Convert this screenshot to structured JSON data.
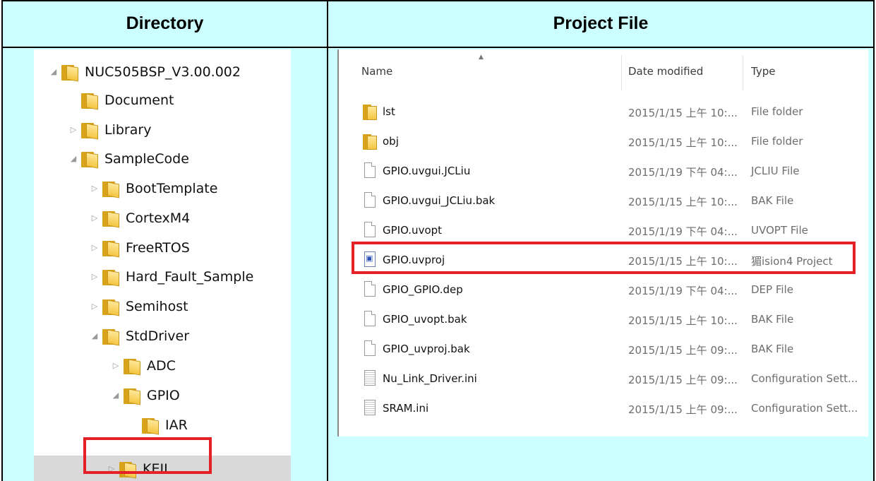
{
  "header": {
    "directory": "Directory",
    "project_file": "Project File"
  },
  "tree": [
    {
      "label": "NUC505BSP_V3.00.002",
      "expander": "◢"
    },
    {
      "label": "Document",
      "expander": ""
    },
    {
      "label": "Library",
      "expander": "▷"
    },
    {
      "label": "SampleCode",
      "expander": "◢"
    },
    {
      "label": "BootTemplate",
      "expander": "▷"
    },
    {
      "label": "CortexM4",
      "expander": "▷"
    },
    {
      "label": "FreeRTOS",
      "expander": "▷"
    },
    {
      "label": "Hard_Fault_Sample",
      "expander": "▷"
    },
    {
      "label": "Semihost",
      "expander": "▷"
    },
    {
      "label": "StdDriver",
      "expander": "◢"
    },
    {
      "label": "ADC",
      "expander": "▷"
    },
    {
      "label": "GPIO",
      "expander": "◢"
    },
    {
      "label": "IAR",
      "expander": ""
    },
    {
      "label": "KEIL",
      "expander": "▷"
    }
  ],
  "file_list": {
    "columns": {
      "name": "Name",
      "date": "Date modified",
      "type": "Type"
    },
    "sort_indicator": "▲",
    "rows": [
      {
        "name": "lst",
        "date": "2015/1/15 上午 10:...",
        "type": "File folder",
        "icon": "folder-icon"
      },
      {
        "name": "obj",
        "date": "2015/1/15 上午 10:...",
        "type": "File folder",
        "icon": "folder-icon"
      },
      {
        "name": "GPIO.uvgui.JCLiu",
        "date": "2015/1/19 下午 04:...",
        "type": "JCLIU File",
        "icon": "file-icon"
      },
      {
        "name": "GPIO.uvgui_JCLiu.bak",
        "date": "2015/1/15 上午 10:...",
        "type": "BAK File",
        "icon": "file-icon"
      },
      {
        "name": "GPIO.uvopt",
        "date": "2015/1/19 下午 04:...",
        "type": "UVOPT File",
        "icon": "file-icon"
      },
      {
        "name": "GPIO.uvproj",
        "date": "2015/1/15 上午 10:...",
        "type": "猸ision4 Project",
        "icon": "project-icon"
      },
      {
        "name": "GPIO_GPIO.dep",
        "date": "2015/1/19 下午 04:...",
        "type": "DEP File",
        "icon": "file-icon"
      },
      {
        "name": "GPIO_uvopt.bak",
        "date": "2015/1/15 上午 10:...",
        "type": "BAK File",
        "icon": "file-icon"
      },
      {
        "name": "GPIO_uvproj.bak",
        "date": "2015/1/15 上午 09:...",
        "type": "BAK File",
        "icon": "file-icon"
      },
      {
        "name": "Nu_Link_Driver.ini",
        "date": "2015/1/15 上午 09:...",
        "type": "Configuration Sett...",
        "icon": "settings-file-icon"
      },
      {
        "name": "SRAM.ini",
        "date": "2015/1/15 上午 09:...",
        "type": "Configuration Sett...",
        "icon": "settings-file-icon"
      }
    ]
  },
  "highlight_color": "#e32126",
  "table_bg_color": "#ccffff"
}
